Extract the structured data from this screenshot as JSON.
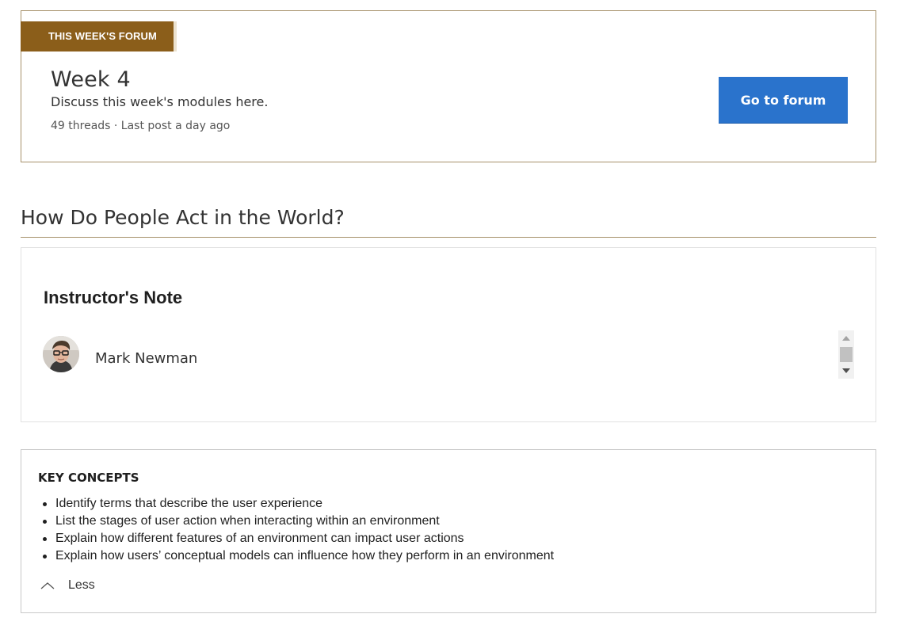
{
  "forum": {
    "tag": "THIS WEEK'S FORUM",
    "title": "Week 4",
    "description": "Discuss this week's modules here.",
    "meta": "49 threads · Last post a day ago",
    "button_label": "Go to forum"
  },
  "section": {
    "heading": "How Do People Act in the World?"
  },
  "note": {
    "title": "Instructor's Note",
    "instructor_name": "Mark Newman"
  },
  "concepts": {
    "title": "KEY CONCEPTS",
    "items": [
      "Identify terms that describe the user experience",
      "List the stages of user action when interacting within an environment",
      "Explain how different features of an environment can impact user actions",
      "Explain how users’ conceptual models can influence how they perform in an environment"
    ],
    "toggle_label": "Less"
  },
  "colors": {
    "forum_tag_bg": "#8b5e1a",
    "accent_border": "#a6916a",
    "button_bg": "#2a73cc"
  },
  "icons": {
    "avatar": "instructor-avatar",
    "toggle": "chevron-up-icon",
    "scroll_up": "scroll-up-arrow-icon",
    "scroll_down": "scroll-down-arrow-icon"
  }
}
